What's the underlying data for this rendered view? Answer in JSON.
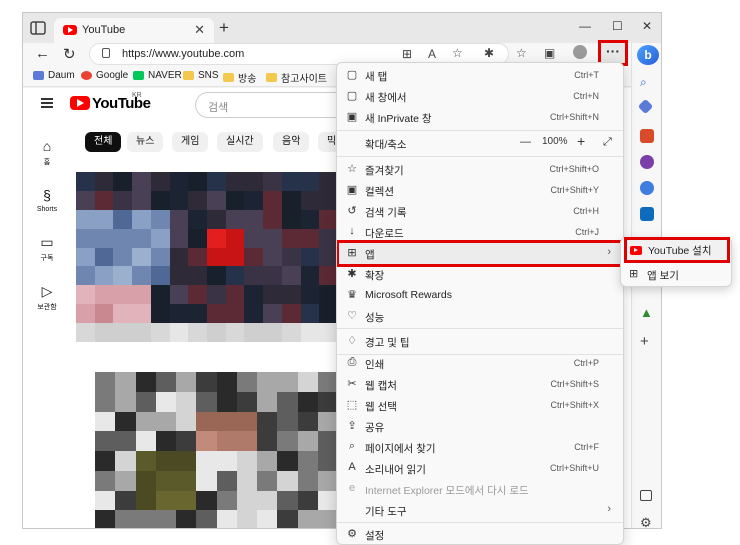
{
  "browser": {
    "tab_title": "YouTube",
    "url": "https://www.youtube.com",
    "more_label": "···",
    "window_controls": [
      "—",
      "☐",
      "✕"
    ]
  },
  "bookmarks": [
    {
      "label": "Daum",
      "icon": "daum-icon",
      "color": "#5b7bd6"
    },
    {
      "label": "Google",
      "icon": "google-icon",
      "color": "#ea4335"
    },
    {
      "label": "NAVER",
      "icon": "naver-icon",
      "color": "#03c75a"
    },
    {
      "label": "SNS",
      "icon": "folder-icon",
      "color": "#f2c94c"
    },
    {
      "label": "방송",
      "icon": "folder-icon",
      "color": "#f2c94c"
    },
    {
      "label": "참고사이트",
      "icon": "folder-icon",
      "color": "#f2c94c"
    }
  ],
  "youtube": {
    "logo_text": "YouTube",
    "logo_region": "KR",
    "search_placeholder": "검색",
    "nav": [
      {
        "label": "홈",
        "icon": "home-icon"
      },
      {
        "label": "Shorts",
        "icon": "shorts-icon"
      },
      {
        "label": "구독",
        "icon": "subscriptions-icon"
      },
      {
        "label": "보관함",
        "icon": "library-icon"
      }
    ],
    "chips": [
      "전체",
      "뉴스",
      "게임",
      "실시간",
      "음악",
      "믹스"
    ]
  },
  "menu": {
    "items": [
      {
        "label": "새 탭",
        "shortcut": "Ctrl+T",
        "icon": "new-tab-icon"
      },
      {
        "label": "새 창에서",
        "shortcut": "Ctrl+N",
        "icon": "new-window-icon"
      },
      {
        "label": "새 InPrivate 창",
        "shortcut": "Ctrl+Shift+N",
        "icon": "inprivate-icon"
      },
      {
        "label": "즐겨찾기",
        "shortcut": "Ctrl+Shift+O",
        "icon": "favorites-icon"
      },
      {
        "label": "컬렉션",
        "shortcut": "Ctrl+Shift+Y",
        "icon": "collections-icon"
      },
      {
        "label": "검색 기록",
        "shortcut": "Ctrl+H",
        "icon": "history-icon"
      },
      {
        "label": "다운로드",
        "shortcut": "Ctrl+J",
        "icon": "download-icon"
      },
      {
        "label": "앱",
        "shortcut": "",
        "icon": "apps-icon"
      },
      {
        "label": "확장",
        "shortcut": "",
        "icon": "extensions-icon"
      },
      {
        "label": "Microsoft Rewards",
        "shortcut": "",
        "icon": "rewards-icon"
      },
      {
        "label": "성능",
        "shortcut": "",
        "icon": "performance-icon"
      },
      {
        "label": "경고 및 팁",
        "shortcut": "",
        "icon": "alerts-icon"
      },
      {
        "label": "인쇄",
        "shortcut": "Ctrl+P",
        "icon": "print-icon"
      },
      {
        "label": "웹 캡처",
        "shortcut": "Ctrl+Shift+S",
        "icon": "web-capture-icon"
      },
      {
        "label": "웹 선택",
        "shortcut": "Ctrl+Shift+X",
        "icon": "web-select-icon"
      },
      {
        "label": "공유",
        "shortcut": "",
        "icon": "share-icon"
      },
      {
        "label": "페이지에서 찾기",
        "shortcut": "Ctrl+F",
        "icon": "find-icon"
      },
      {
        "label": "소리내어 읽기",
        "shortcut": "Ctrl+Shift+U",
        "icon": "read-aloud-icon"
      },
      {
        "label": "Internet Explorer 모드에서 다시 로드",
        "shortcut": "",
        "icon": "ie-mode-icon"
      },
      {
        "label": "기타 도구",
        "shortcut": "",
        "icon": "more-tools-icon"
      },
      {
        "label": "설정",
        "shortcut": "",
        "icon": "settings-icon"
      }
    ],
    "zoom": {
      "label": "확대/축소",
      "value": "100%",
      "minus": "—",
      "plus": "+"
    }
  },
  "submenu": {
    "install_label": "YouTube 설치",
    "view_label": "앱 보기"
  },
  "colors": {
    "highlight": "#e10000",
    "youtube_red": "#ff0000"
  }
}
